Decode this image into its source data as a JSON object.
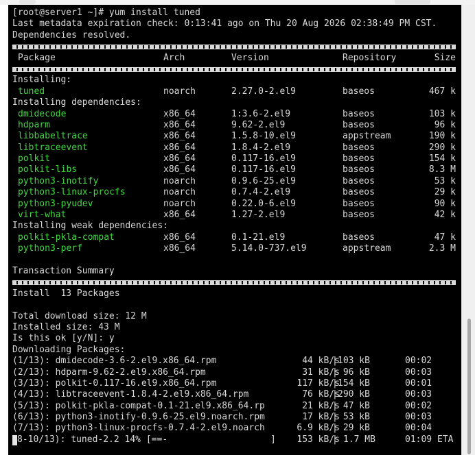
{
  "terminal": {
    "prompt": "[root@server1 ~]# yum install tuned",
    "metadata_line": "Last metadata expiration check: 0:13:41 ago on Thu 20 Aug 2026 02:38:49 PM CST.",
    "deps_resolved": "Dependencies resolved.",
    "headers": {
      "package": "Package",
      "arch": "Arch",
      "version": "Version",
      "repository": "Repository",
      "size": "Size"
    },
    "installing_label": "Installing:",
    "installing": [
      {
        "package": "tuned",
        "arch": "noarch",
        "version": "2.27.0-2.el9",
        "repository": "baseos",
        "size": "467 k"
      }
    ],
    "deps_label": "Installing dependencies:",
    "dependencies": [
      {
        "package": "dmidecode",
        "arch": "x86_64",
        "version": "1:3.6-2.el9",
        "repository": "baseos",
        "size": "103 k"
      },
      {
        "package": "hdparm",
        "arch": "x86_64",
        "version": "9.62-2.el9",
        "repository": "baseos",
        "size": "96 k"
      },
      {
        "package": "libbabeltrace",
        "arch": "x86_64",
        "version": "1.5.8-10.el9",
        "repository": "appstream",
        "size": "190 k"
      },
      {
        "package": "libtraceevent",
        "arch": "x86_64",
        "version": "1.8.4-2.el9",
        "repository": "baseos",
        "size": "290 k"
      },
      {
        "package": "polkit",
        "arch": "x86_64",
        "version": "0.117-16.el9",
        "repository": "baseos",
        "size": "154 k"
      },
      {
        "package": "polkit-libs",
        "arch": "x86_64",
        "version": "0.117-16.el9",
        "repository": "baseos",
        "size": "8.3 M"
      },
      {
        "package": "python3-inotify",
        "arch": "noarch",
        "version": "0.9.6-25.el9",
        "repository": "baseos",
        "size": "53 k"
      },
      {
        "package": "python3-linux-procfs",
        "arch": "noarch",
        "version": "0.7.4-2.el9",
        "repository": "baseos",
        "size": "29 k"
      },
      {
        "package": "python3-pyudev",
        "arch": "noarch",
        "version": "0.22.0-6.el9",
        "repository": "baseos",
        "size": "90 k"
      },
      {
        "package": "virt-what",
        "arch": "x86_64",
        "version": "1.27-2.el9",
        "repository": "baseos",
        "size": "42 k"
      }
    ],
    "weak_label": "Installing weak dependencies:",
    "weak": [
      {
        "package": "polkit-pkla-compat",
        "arch": "x86_64",
        "version": "0.1-21.el9",
        "repository": "baseos",
        "size": "47 k"
      },
      {
        "package": "python3-perf",
        "arch": "x86_64",
        "version": "5.14.0-737.el9",
        "repository": "appstream",
        "size": "2.3 M"
      }
    ],
    "summary_label": "Transaction Summary",
    "install_count": "Install  13 Packages",
    "total_download": "Total download size: 12 M",
    "installed_size": "Installed size: 43 M",
    "confirm": "Is this ok [y/N]: y",
    "downloading_label": "Downloading Packages:",
    "downloads": [
      {
        "file": "(1/13): dmidecode-3.6-2.el9.x86_64.rpm",
        "rate": "44 kB/s",
        "size": "103 kB",
        "time": "00:02"
      },
      {
        "file": "(2/13): hdparm-9.62-2.el9.x86_64.rpm",
        "rate": "31 kB/s",
        "size": " 96 kB",
        "time": "00:03"
      },
      {
        "file": "(3/13): polkit-0.117-16.el9.x86_64.rpm",
        "rate": "117 kB/s",
        "size": "154 kB",
        "time": "00:01"
      },
      {
        "file": "(4/13): libtraceevent-1.8.4-2.el9.x86_64.rpm",
        "rate": "76 kB/s",
        "size": "290 kB",
        "time": "00:03"
      },
      {
        "file": "(5/13): polkit-pkla-compat-0.1-21.el9.x86_64.rp",
        "rate": "21 kB/s",
        "size": " 47 kB",
        "time": "00:02"
      },
      {
        "file": "(6/13): python3-inotify-0.9.6-25.el9.noarch.rpm",
        "rate": "17 kB/s",
        "size": " 53 kB",
        "time": "00:03"
      },
      {
        "file": "(7/13): python3-linux-procfs-0.7.4-2.el9.noarch",
        "rate": "6.9 kB/s",
        "size": " 29 kB",
        "time": "00:04"
      }
    ],
    "progress": {
      "label": "8-10/13): tuned-2.2 14% [==-",
      "bracket_end": "]",
      "rate": "153 kB/s",
      "size": "1.7 MB",
      "eta": "01:09 ETA"
    }
  },
  "colors": {
    "background": "#000000",
    "text": "#d9d9d9",
    "package": "#3fd93f"
  }
}
